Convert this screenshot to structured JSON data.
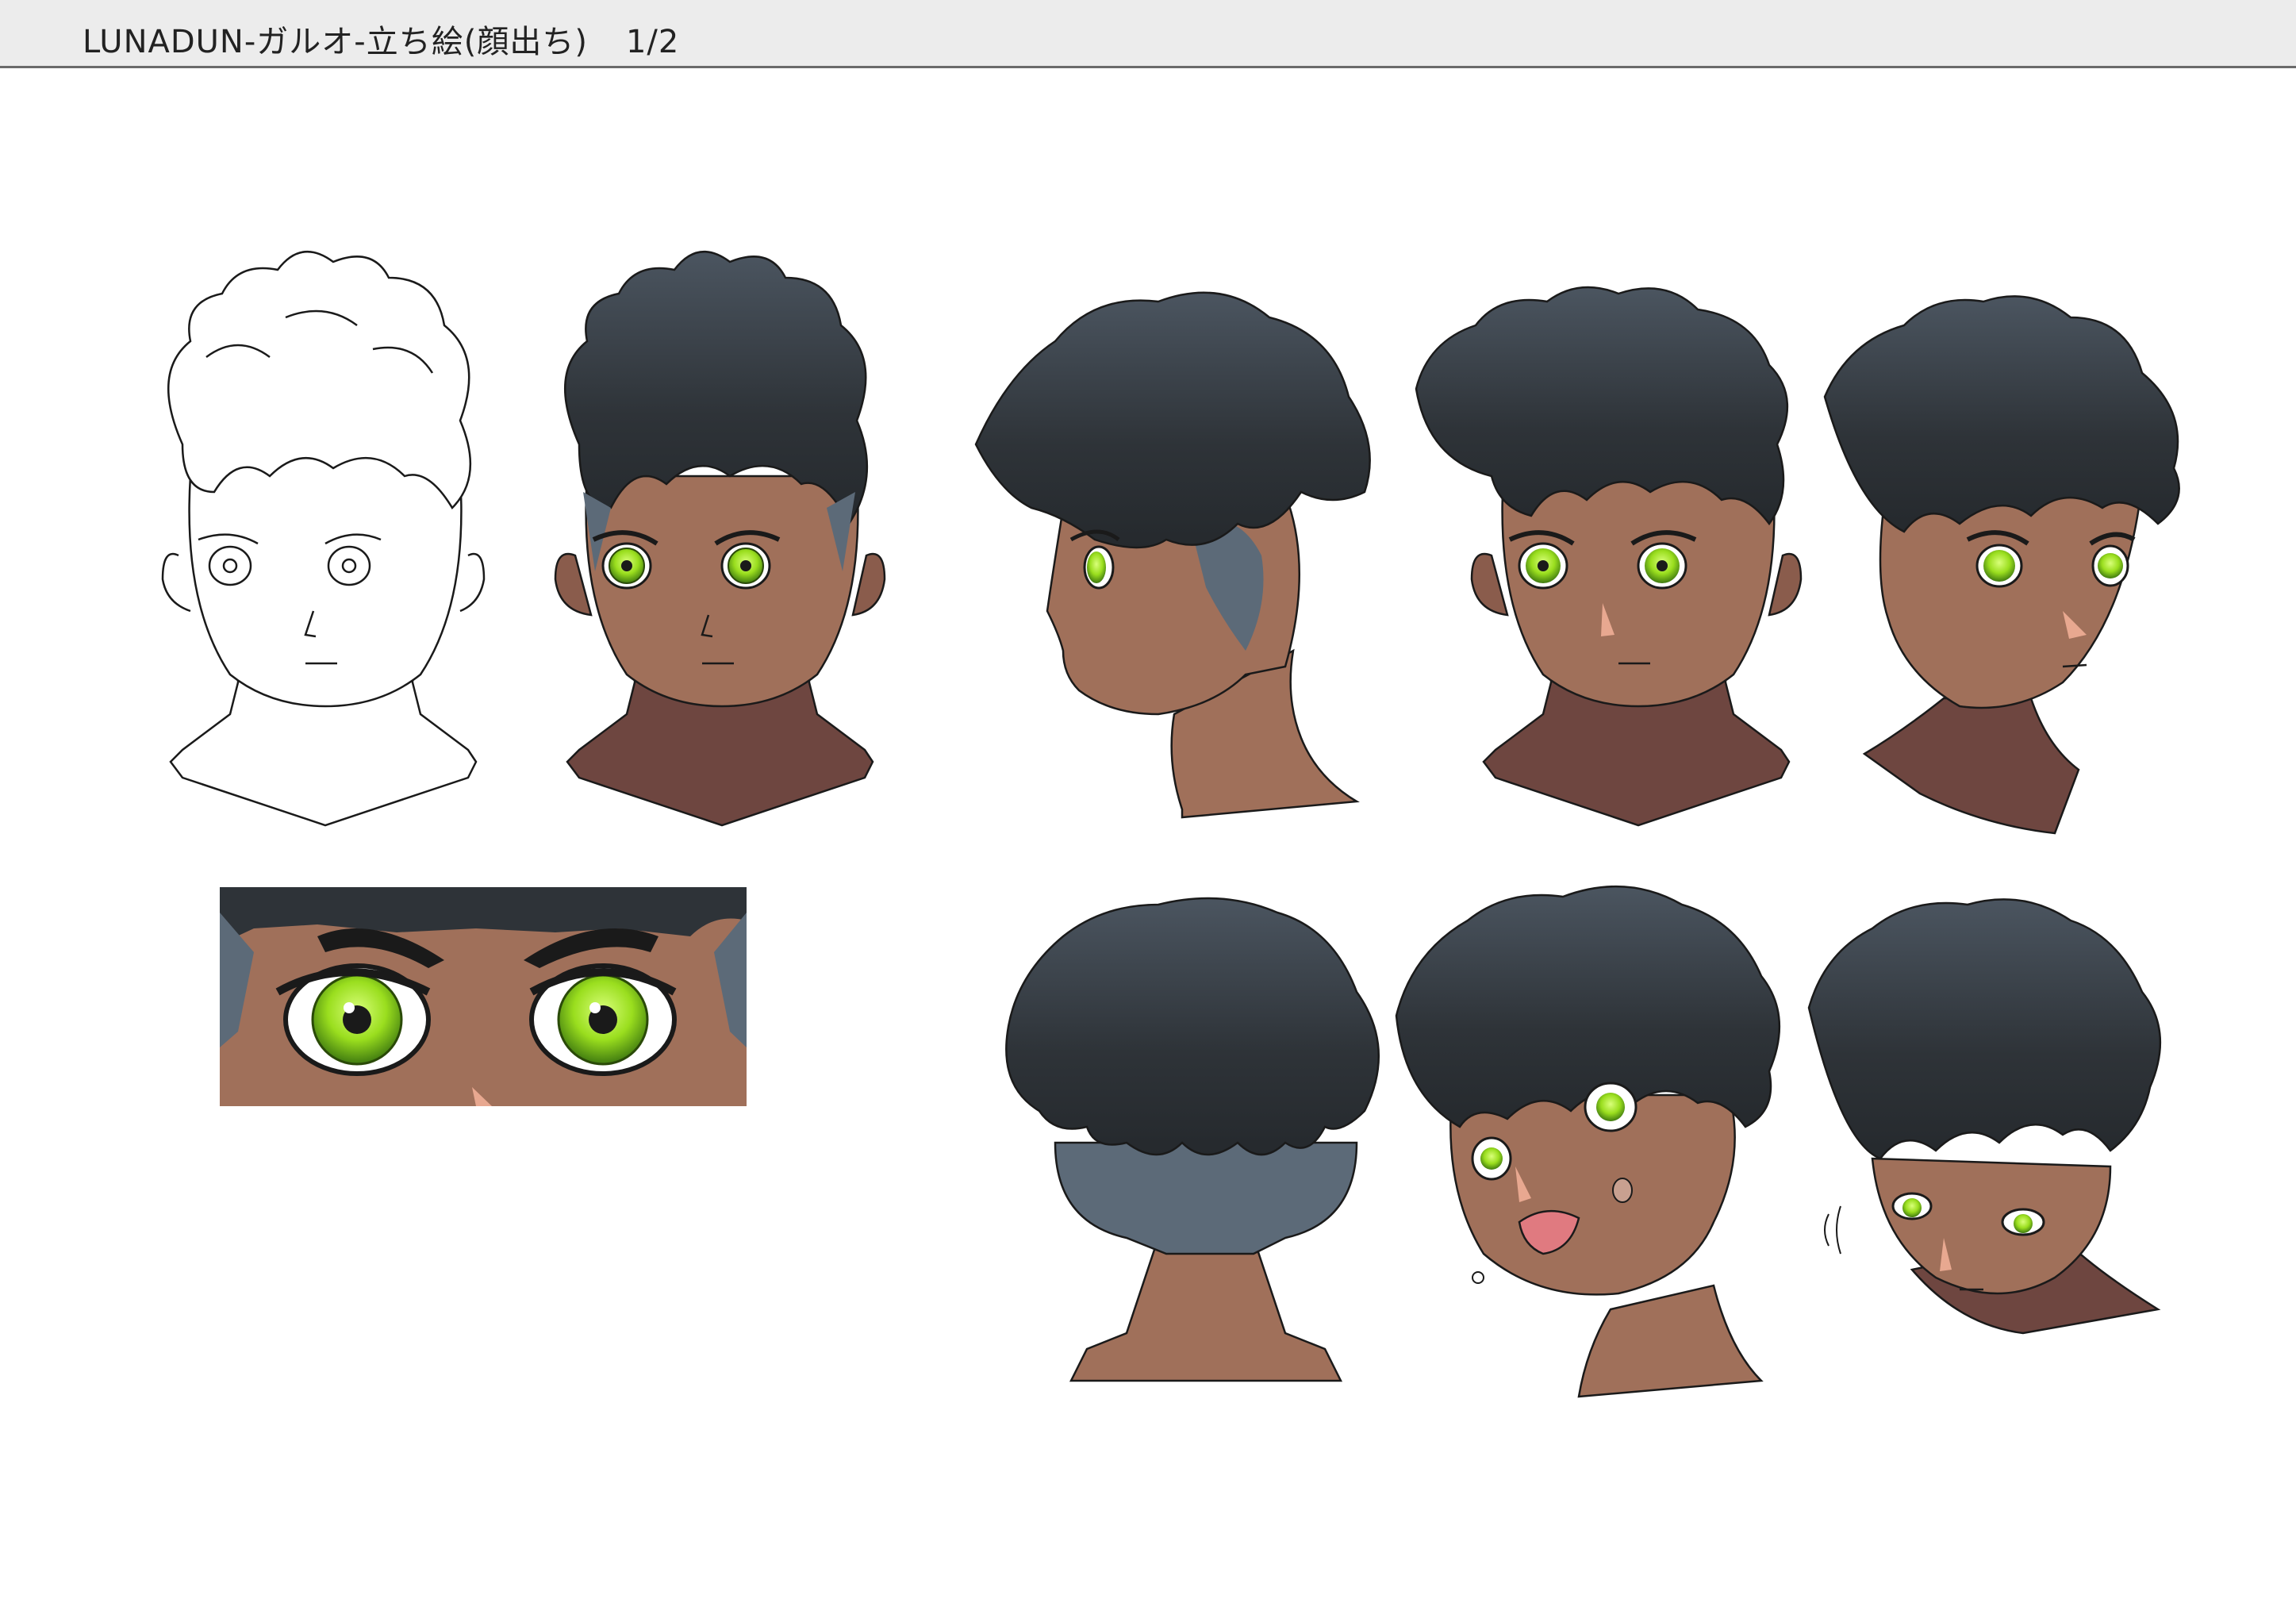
{
  "header": {
    "title": "LUNADUN-ガルオ-立ち絵(顔出ち)",
    "page": "1/2"
  },
  "colors": {
    "hair": "#2e3338",
    "hair_highlight": "#4b5560",
    "undercut": "#5c6a78",
    "skin": "#a0705a",
    "skin_shadow": "#6e4640",
    "eye_iris": "#9ade1e",
    "eye_dark": "#3f7a10",
    "line": "#1a1a1a",
    "header_bg": "#ececec"
  },
  "views": [
    {
      "id": "lineart-front",
      "kind": "lineart"
    },
    {
      "id": "color-front",
      "kind": "front"
    },
    {
      "id": "profile-left",
      "kind": "profile"
    },
    {
      "id": "front-neutral",
      "kind": "front"
    },
    {
      "id": "three-quarter",
      "kind": "three-quarter"
    },
    {
      "id": "back-view",
      "kind": "back"
    },
    {
      "id": "surprised-tilt",
      "kind": "tilt"
    },
    {
      "id": "head-down",
      "kind": "down"
    },
    {
      "id": "eye-closeup",
      "kind": "closeup"
    }
  ]
}
